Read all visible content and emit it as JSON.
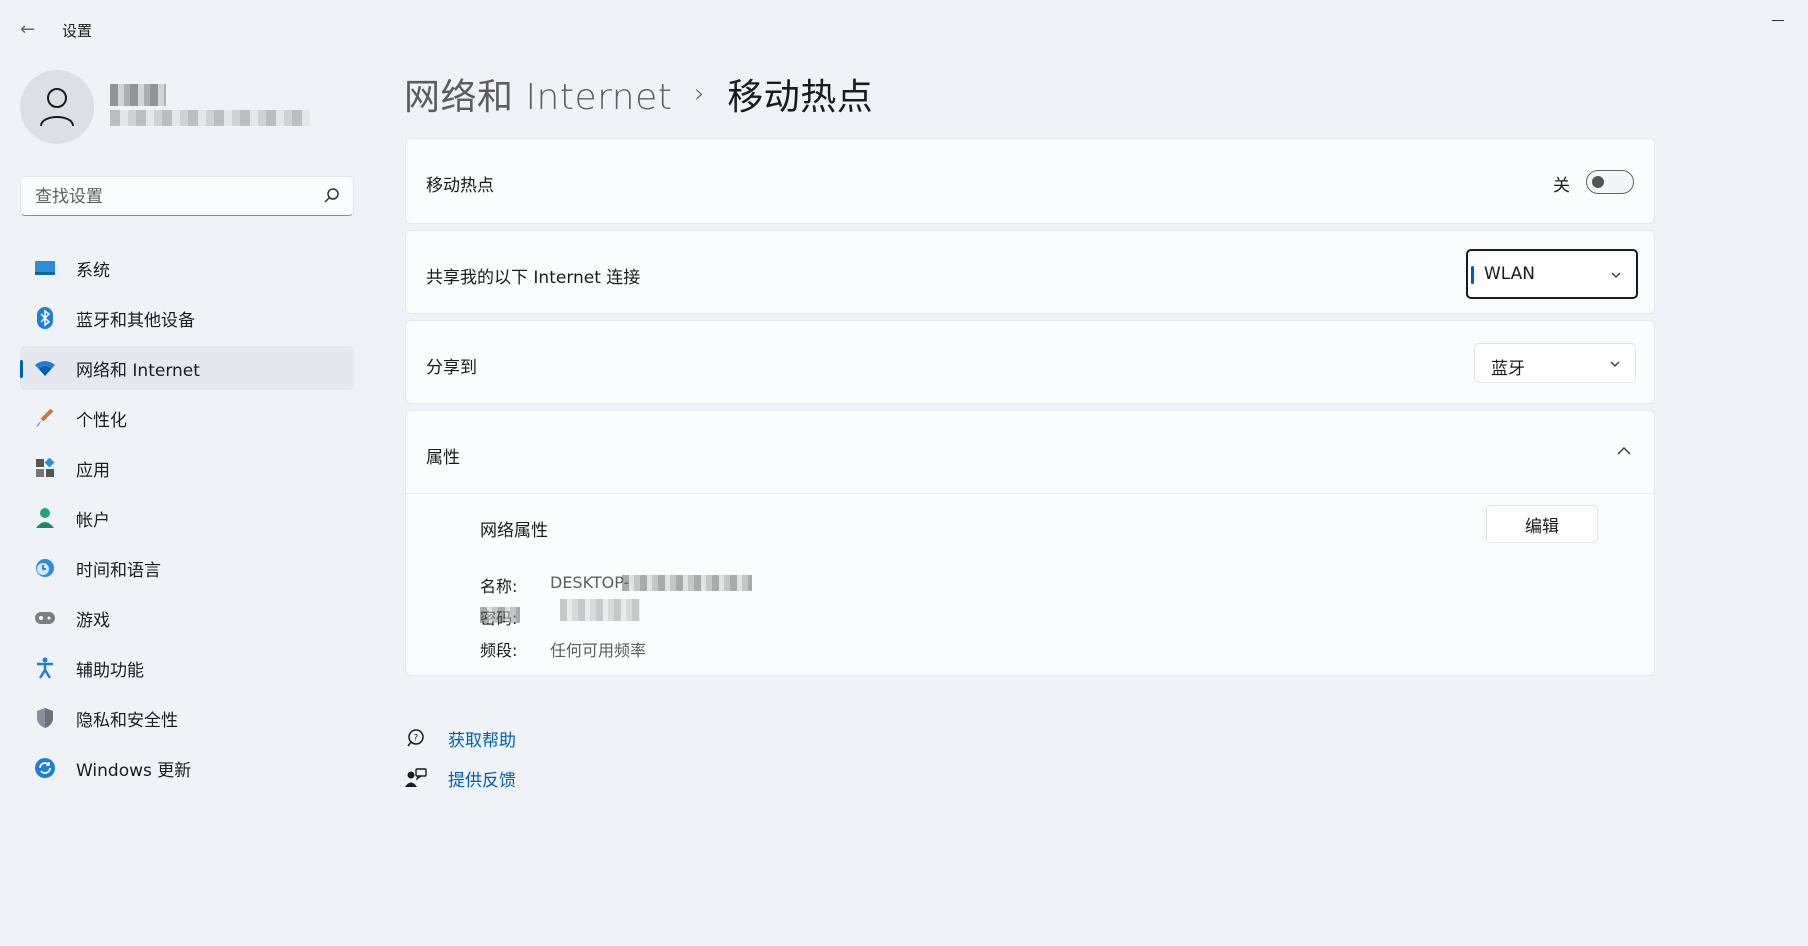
{
  "window": {
    "title": "设置"
  },
  "profile": {
    "name": "",
    "email": ""
  },
  "search": {
    "placeholder": "查找设置"
  },
  "sidebar": {
    "items": [
      {
        "label": "系统",
        "icon": "system-icon",
        "active": false
      },
      {
        "label": "蓝牙和其他设备",
        "icon": "bluetooth-icon",
        "active": false
      },
      {
        "label": "网络和 Internet",
        "icon": "wifi-icon",
        "active": true
      },
      {
        "label": "个性化",
        "icon": "brush-icon",
        "active": false
      },
      {
        "label": "应用",
        "icon": "apps-icon",
        "active": false
      },
      {
        "label": "帐户",
        "icon": "account-icon",
        "active": false
      },
      {
        "label": "时间和语言",
        "icon": "clock-globe-icon",
        "active": false
      },
      {
        "label": "游戏",
        "icon": "gamepad-icon",
        "active": false
      },
      {
        "label": "辅助功能",
        "icon": "accessibility-icon",
        "active": false
      },
      {
        "label": "隐私和安全性",
        "icon": "shield-icon",
        "active": false
      },
      {
        "label": "Windows 更新",
        "icon": "update-icon",
        "active": false
      }
    ]
  },
  "breadcrumb": {
    "parent": "网络和 Internet",
    "separator": "›",
    "current": "移动热点"
  },
  "hotspot": {
    "label": "移动热点",
    "state_text": "关",
    "enabled": false
  },
  "share_from": {
    "label": "共享我的以下 Internet 连接",
    "value": "WLAN"
  },
  "share_to": {
    "label": "分享到",
    "value": "蓝牙"
  },
  "properties": {
    "header": "属性",
    "section_title": "网络属性",
    "edit_label": "编辑",
    "rows": [
      {
        "key": "名称:",
        "value": "DESKTOP-"
      },
      {
        "key": "密码:",
        "value": ""
      },
      {
        "key": "频段:",
        "value": "任何可用频率"
      }
    ]
  },
  "links": {
    "help": "获取帮助",
    "feedback": "提供反馈"
  },
  "colors": {
    "accent": "#005fb8",
    "background": "#eff3f8",
    "card": "#fbfcfd"
  }
}
